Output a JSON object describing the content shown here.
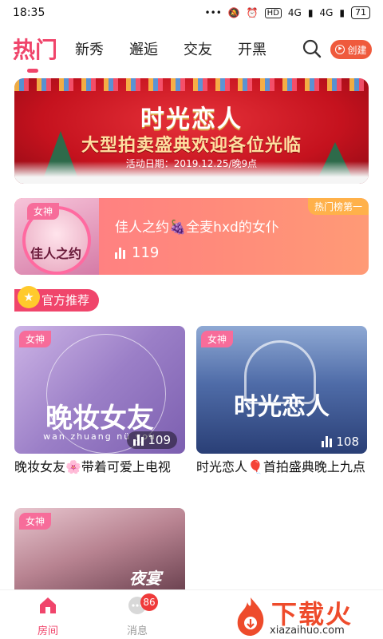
{
  "status": {
    "time": "18:35",
    "signal1": "4G",
    "signal2": "4G",
    "battery": "71"
  },
  "topnav": {
    "active_tab": "热门",
    "tabs": [
      "新秀",
      "邂逅",
      "交友",
      "开黑"
    ],
    "create_label": "创建"
  },
  "banner": {
    "title": "时光恋人",
    "subtitle": "大型拍卖盛典欢迎各位光临",
    "date": "活动日期：2019.12.25/晚9点"
  },
  "hot_card": {
    "tag": "女神",
    "title": "佳人之约🍇全麦hxd的女仆",
    "count": "119",
    "rank": "热门榜第一",
    "thumb_text": "佳人之约"
  },
  "recommend": {
    "label": "官方推荐"
  },
  "rooms": [
    {
      "tag": "女神",
      "overlay": "晚妆女友",
      "overlay_sub": "wan zhuang nü you",
      "count": "109",
      "caption": "晚妆女友🌸带着可爱上电视"
    },
    {
      "tag": "女神",
      "overlay": "时光恋人",
      "count": "108",
      "caption": "时光恋人🎈首拍盛典晚上九点"
    },
    {
      "tag": "女神",
      "overlay": "夜宴"
    }
  ],
  "bottomnav": {
    "rooms_label": "房间",
    "messages_label": "消息",
    "messages_badge": "86"
  },
  "watermark": {
    "title": "下载火",
    "domain": "xiazaihuo.com"
  },
  "colors": {
    "accent": "#f0456b",
    "create": "#ef5a3c",
    "banner_red": "#c5121e"
  }
}
